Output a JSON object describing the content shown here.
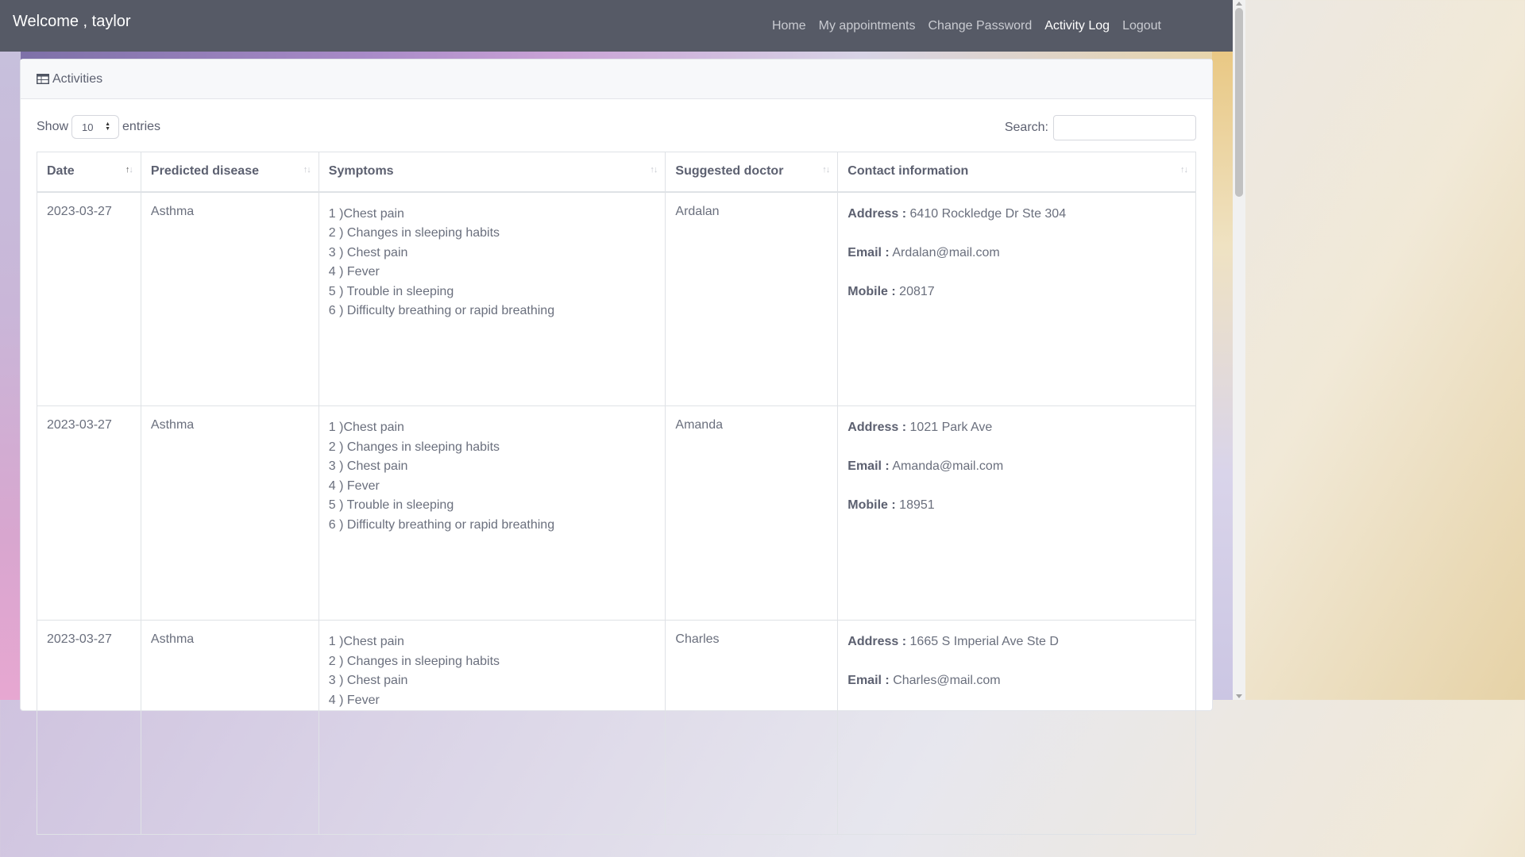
{
  "navbar": {
    "welcome": "Welcome , taylor",
    "links": [
      "Home",
      "My appointments",
      "Change Password",
      "Activity Log",
      "Logout"
    ],
    "active": "Activity Log"
  },
  "card": {
    "title": "Activities",
    "show_label": "Show",
    "entries_value": "10",
    "entries_label": "entries",
    "search_label": "Search:",
    "search_value": ""
  },
  "table": {
    "headers": [
      "Date",
      "Predicted disease",
      "Symptoms",
      "Suggested doctor",
      "Contact information"
    ],
    "rows": [
      {
        "date": "2023-03-27",
        "disease": "Asthma",
        "symptoms": [
          "1 )Chest pain",
          "2 ) Changes in sleeping habits",
          "3 ) Chest pain",
          "4 ) Fever",
          "5 ) Trouble in sleeping",
          "6 ) Difficulty breathing or rapid breathing"
        ],
        "doctor": "Ardalan",
        "address_label": "Address :",
        "address": "6410 Rockledge Dr Ste 304",
        "email_label": "Email :",
        "email": "Ardalan@mail.com",
        "mobile_label": "Mobile :",
        "mobile": "20817"
      },
      {
        "date": "2023-03-27",
        "disease": "Asthma",
        "symptoms": [
          "1 )Chest pain",
          "2 ) Changes in sleeping habits",
          "3 ) Chest pain",
          "4 ) Fever",
          "5 ) Trouble in sleeping",
          "6 ) Difficulty breathing or rapid breathing"
        ],
        "doctor": "Amanda",
        "address_label": "Address :",
        "address": "1021 Park Ave",
        "email_label": "Email :",
        "email": "Amanda@mail.com",
        "mobile_label": "Mobile :",
        "mobile": "18951"
      },
      {
        "date": "2023-03-27",
        "disease": "Asthma",
        "symptoms": [
          "1 )Chest pain",
          "2 ) Changes in sleeping habits",
          "3 ) Chest pain",
          "4 ) Fever"
        ],
        "doctor": "Charles",
        "address_label": "Address :",
        "address": "1665 S Imperial Ave Ste D",
        "email_label": "Email :",
        "email": "Charles@mail.com",
        "mobile_label": "",
        "mobile": ""
      }
    ]
  }
}
